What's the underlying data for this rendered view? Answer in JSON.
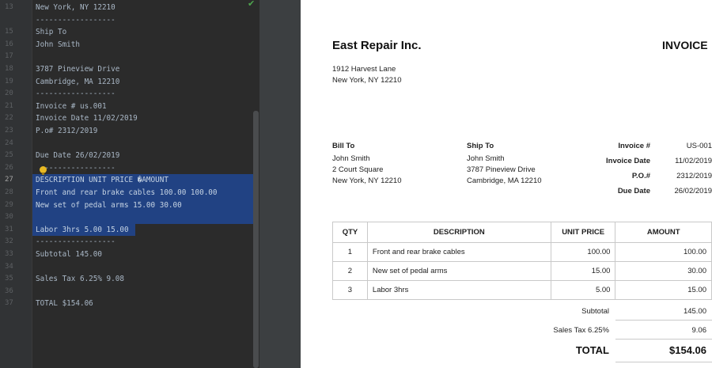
{
  "editor": {
    "line_numbers": [
      "13",
      "15",
      "16",
      "17",
      "18",
      "19",
      "20",
      "21",
      "22",
      "23",
      "24",
      "25",
      "26",
      "27",
      "28",
      "29",
      "30",
      "31",
      "32",
      "33",
      "34",
      "35",
      "36",
      "37"
    ],
    "lines": [
      {
        "num": "13",
        "text": "New York, NY 12210"
      },
      {
        "num": "",
        "text": "------------------"
      },
      {
        "num": "15",
        "text": "Ship To"
      },
      {
        "num": "16",
        "text": "John Smith"
      },
      {
        "num": "17",
        "text": ""
      },
      {
        "num": "18",
        "text": "3787 Pineview Drive"
      },
      {
        "num": "19",
        "text": "Cambridge, MA 12210"
      },
      {
        "num": "20",
        "text": "------------------"
      },
      {
        "num": "21",
        "text": "Invoice # us.001"
      },
      {
        "num": "22",
        "text": "Invoice Date 11/02/2019"
      },
      {
        "num": "23",
        "text": "P.o# 2312/2019"
      },
      {
        "num": "24",
        "text": ""
      },
      {
        "num": "25",
        "text": "Due Date 26/02/2019"
      },
      {
        "num": "26",
        "text": "  ----------------"
      },
      {
        "num": "27",
        "text": "DESCRIPTION UNIT PRICE �AMOUNT"
      },
      {
        "num": "28",
        "text": "Front and rear brake cables 100.00 100.00"
      },
      {
        "num": "29",
        "text": "New set of pedal arms 15.00 30.00"
      },
      {
        "num": "30",
        "text": ""
      },
      {
        "num": "31",
        "text": "Labor 3hrs 5.00 15.00"
      },
      {
        "num": "32",
        "text": "------------------"
      },
      {
        "num": "33",
        "text": "Subtotal 145.00"
      },
      {
        "num": "34",
        "text": ""
      },
      {
        "num": "35",
        "text": "Sales Tax 6.25% 9.08"
      },
      {
        "num": "36",
        "text": ""
      },
      {
        "num": "37",
        "text": "TOTAL $154.06"
      }
    ]
  },
  "invoice": {
    "company": "East Repair Inc.",
    "title": "INVOICE",
    "company_address_1": "1912 Harvest Lane",
    "company_address_2": "New York, NY 12210",
    "bill_to": {
      "label": "Bill To",
      "name": "John Smith",
      "address_1": "2 Court Square",
      "address_2": "New York, NY 12210"
    },
    "ship_to": {
      "label": "Ship To",
      "name": "John Smith",
      "address_1": "3787 Pineview Drive",
      "address_2": "Cambridge, MA 12210"
    },
    "meta": [
      {
        "label": "Invoice #",
        "value": "US-001"
      },
      {
        "label": "Invoice Date",
        "value": "11/02/2019"
      },
      {
        "label": "P.O.#",
        "value": "2312/2019"
      },
      {
        "label": "Due Date",
        "value": "26/02/2019"
      }
    ],
    "table": {
      "headers": [
        "QTY",
        "DESCRIPTION",
        "UNIT PRICE",
        "AMOUNT"
      ],
      "rows": [
        [
          "1",
          "Front and rear brake cables",
          "100.00",
          "100.00"
        ],
        [
          "2",
          "New set of pedal arms",
          "15.00",
          "30.00"
        ],
        [
          "3",
          "Labor 3hrs",
          "5.00",
          "15.00"
        ]
      ]
    },
    "subtotal_label": "Subtotal",
    "subtotal_value": "145.00",
    "tax_label": "Sales Tax 6.25%",
    "tax_value": "9.06",
    "total_label": "TOTAL",
    "total_value": "$154.06"
  }
}
